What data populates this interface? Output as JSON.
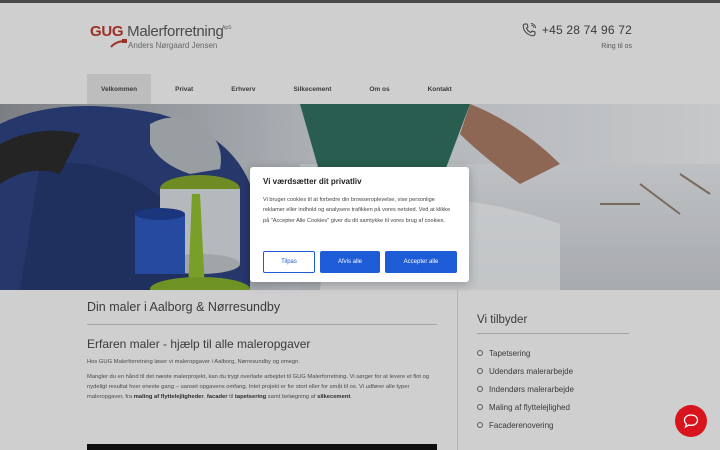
{
  "header": {
    "logo": {
      "brand_prefix": "GUG",
      "brand_rest": " Malerforretning",
      "aps": "ApS",
      "owner": "Anders Nørgaard Jensen"
    },
    "phone": "+45 28 74 96 72",
    "phone_sub": "Ring til os"
  },
  "nav": {
    "items": [
      {
        "label": "Velkommen"
      },
      {
        "label": "Privat"
      },
      {
        "label": "Erhverv"
      },
      {
        "label": "Silkecement"
      },
      {
        "label": "Om os"
      },
      {
        "label": "Kontakt"
      }
    ]
  },
  "main": {
    "title": "Din maler i Aalborg & Nørresundby",
    "subtitle": "Erfaren maler - hjælp til alle maleropgaver",
    "intro": "Hos GUG Malerforretning løser vi maleropgaver i Aalborg, Nørresundby og omegn.",
    "body_1": "Mangler du en hånd til det næste malerprojekt, kan du trygt overlade arbejdet til GUG Malerforretning. Vi sørger for at levere et flot og nydeligt resultat hver eneste gang – uanset opgavens omfang. Intet projekt er for stort eller for småt til os. Vi udfører alle typer maleropgaver, fra ",
    "bold_1": "maling af flyttelejligheder",
    "sep_1": ", ",
    "bold_2": "facader",
    "sep_2": " til ",
    "bold_3": "tapetsering",
    "sep_3": " samt belægning af ",
    "bold_4": "silkecement",
    "end": "."
  },
  "sidebar": {
    "title": "Vi tilbyder",
    "items": [
      {
        "label": "Tapetsering"
      },
      {
        "label": "Udendørs malerarbejde"
      },
      {
        "label": "Indendørs malerarbejde"
      },
      {
        "label": "Maling af flyttelejlighed"
      },
      {
        "label": "Facaderenovering"
      }
    ]
  },
  "cookie": {
    "title": "Vi værdsætter dit privatliv",
    "text": "Vi bruger cookies til at forbedre din browseroplevelse, vise personlige reklamer eller indhold og analysere trafikken på vores netsted. Ved at klikke på \"Accepter Alle Cookies\" giver du dit samtykke til vores brug af cookies.",
    "customize": "Tilpas",
    "reject": "Afvis alle",
    "accept": "Accepter alle"
  },
  "colors": {
    "accent": "#1e5bd6",
    "brand_red": "#b23a2c",
    "chat": "#d8141c"
  },
  "icons": {
    "phone": "phone-icon",
    "list_bullet": "circle-check-icon",
    "chat": "chat-bubble-icon"
  }
}
